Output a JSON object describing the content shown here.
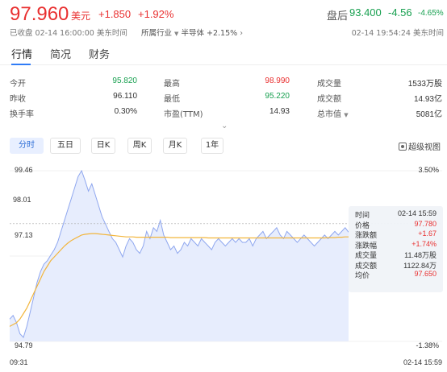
{
  "quote": {
    "price": "97.960",
    "unit": "美元",
    "change": "+1.850",
    "change_pct": "+1.92%",
    "status": "已收盘 02-14 16:00:00 美东时间",
    "industry_label": "所属行业",
    "industry_name": "半导体",
    "industry_change": "+2.15%",
    "afterhours_label": "盘后",
    "afterhours_price": "93.400",
    "afterhours_change": "-4.56",
    "afterhours_pct": "-4.65%",
    "afterhours_time": "02-14 19:54:24 美东时间",
    "colors": {
      "up": "#e93030",
      "down": "#18a050",
      "accent": "#2f7cf6"
    }
  },
  "tabs": [
    "行情",
    "简况",
    "财务"
  ],
  "stats": [
    {
      "label": "今开",
      "value": "95.820",
      "color": "green"
    },
    {
      "label": "最高",
      "value": "98.990",
      "color": "red"
    },
    {
      "label": "成交量",
      "value": "1533万股",
      "color": ""
    },
    {
      "label": "昨收",
      "value": "96.110",
      "color": ""
    },
    {
      "label": "最低",
      "value": "95.220",
      "color": "green"
    },
    {
      "label": "成交额",
      "value": "14.93亿",
      "color": ""
    },
    {
      "label": "换手率",
      "value": "0.30%",
      "color": ""
    },
    {
      "label": "市盈(TTM)",
      "value": "14.93",
      "color": ""
    },
    {
      "label": "总市值",
      "value": "5081亿",
      "color": ""
    }
  ],
  "periods": [
    "分时",
    "五日",
    "日K",
    "周K",
    "月K",
    "1年"
  ],
  "superview_label": "超级视图",
  "chart_data": {
    "type": "line",
    "y_left_ticks": [
      "99.46",
      "98.01",
      "97.13",
      "94.79"
    ],
    "y_right_ticks": [
      "3.50%",
      "-1.38%"
    ],
    "x_start_label": "09:31",
    "x_end_label": "02-14 15:59",
    "ylim": [
      94.79,
      99.46
    ],
    "prev_close": 96.11,
    "series": [
      {
        "values": [
          95.4,
          95.5,
          95.3,
          95.0,
          94.9,
          95.2,
          95.6,
          96.0,
          96.4,
          96.7,
          96.9,
          97.0,
          97.15,
          97.3,
          97.5,
          97.8,
          98.1,
          98.4,
          98.7,
          99.0,
          99.3,
          99.46,
          99.2,
          98.9,
          99.1,
          98.8,
          98.5,
          98.2,
          98.0,
          97.8,
          97.6,
          97.5,
          97.3,
          97.1,
          97.4,
          97.6,
          97.5,
          97.3,
          97.2,
          97.4,
          97.8,
          97.6,
          97.9,
          97.8,
          98.1,
          97.7,
          97.5,
          97.3,
          97.4,
          97.2,
          97.3,
          97.5,
          97.4,
          97.6,
          97.5,
          97.4,
          97.6,
          97.5,
          97.4,
          97.3,
          97.5,
          97.6,
          97.5,
          97.4,
          97.5,
          97.6,
          97.5,
          97.6,
          97.5,
          97.5,
          97.6,
          97.4,
          97.6,
          97.7,
          97.8,
          97.6,
          97.7,
          97.8,
          97.9,
          97.7,
          97.6,
          97.8,
          97.7,
          97.6,
          97.5,
          97.6,
          97.7,
          97.6,
          97.5,
          97.4,
          97.5,
          97.6,
          97.7,
          97.6,
          97.7,
          97.8,
          97.7,
          97.8,
          97.9,
          97.78
        ]
      },
      {
        "values": [
          95.2,
          95.25,
          95.3,
          95.4,
          95.55,
          95.7,
          95.9,
          96.1,
          96.3,
          96.5,
          96.7,
          96.85,
          97.0,
          97.1,
          97.2,
          97.3,
          97.4,
          97.48,
          97.55,
          97.6,
          97.65,
          97.7,
          97.72,
          97.73,
          97.74,
          97.74,
          97.73,
          97.72,
          97.71,
          97.7,
          97.69,
          97.68,
          97.67,
          97.66,
          97.65,
          97.65,
          97.65,
          97.64,
          97.64,
          97.64,
          97.64,
          97.64,
          97.64,
          97.64,
          97.64,
          97.64,
          97.64,
          97.63,
          97.63,
          97.63,
          97.63,
          97.63,
          97.63,
          97.63,
          97.63,
          97.63,
          97.63,
          97.63,
          97.62,
          97.62,
          97.62,
          97.62,
          97.62,
          97.62,
          97.62,
          97.62,
          97.62,
          97.62,
          97.62,
          97.62,
          97.62,
          97.62,
          97.62,
          97.62,
          97.62,
          97.62,
          97.62,
          97.62,
          97.62,
          97.62,
          97.62,
          97.62,
          97.62,
          97.62,
          97.62,
          97.62,
          97.62,
          97.62,
          97.62,
          97.62,
          97.62,
          97.62,
          97.62,
          97.63,
          97.63,
          97.63,
          97.64,
          97.64,
          97.65,
          97.65
        ]
      }
    ],
    "colors": {
      "price": "#8fa7ef",
      "avg": "#f2b53b",
      "fill": "#e7edfd"
    }
  },
  "tooltip": {
    "time_label": "时间",
    "time": "02-14 15:59",
    "price_label": "价格",
    "price": "97.780",
    "chg_label": "涨跌额",
    "chg": "+1.67",
    "pct_label": "涨跌幅",
    "pct": "+1.74%",
    "vol_label": "成交量",
    "vol": "11.48万股",
    "amt_label": "成交额",
    "amt": "1122.84万",
    "avg_label": "均价",
    "avg": "97.650"
  }
}
